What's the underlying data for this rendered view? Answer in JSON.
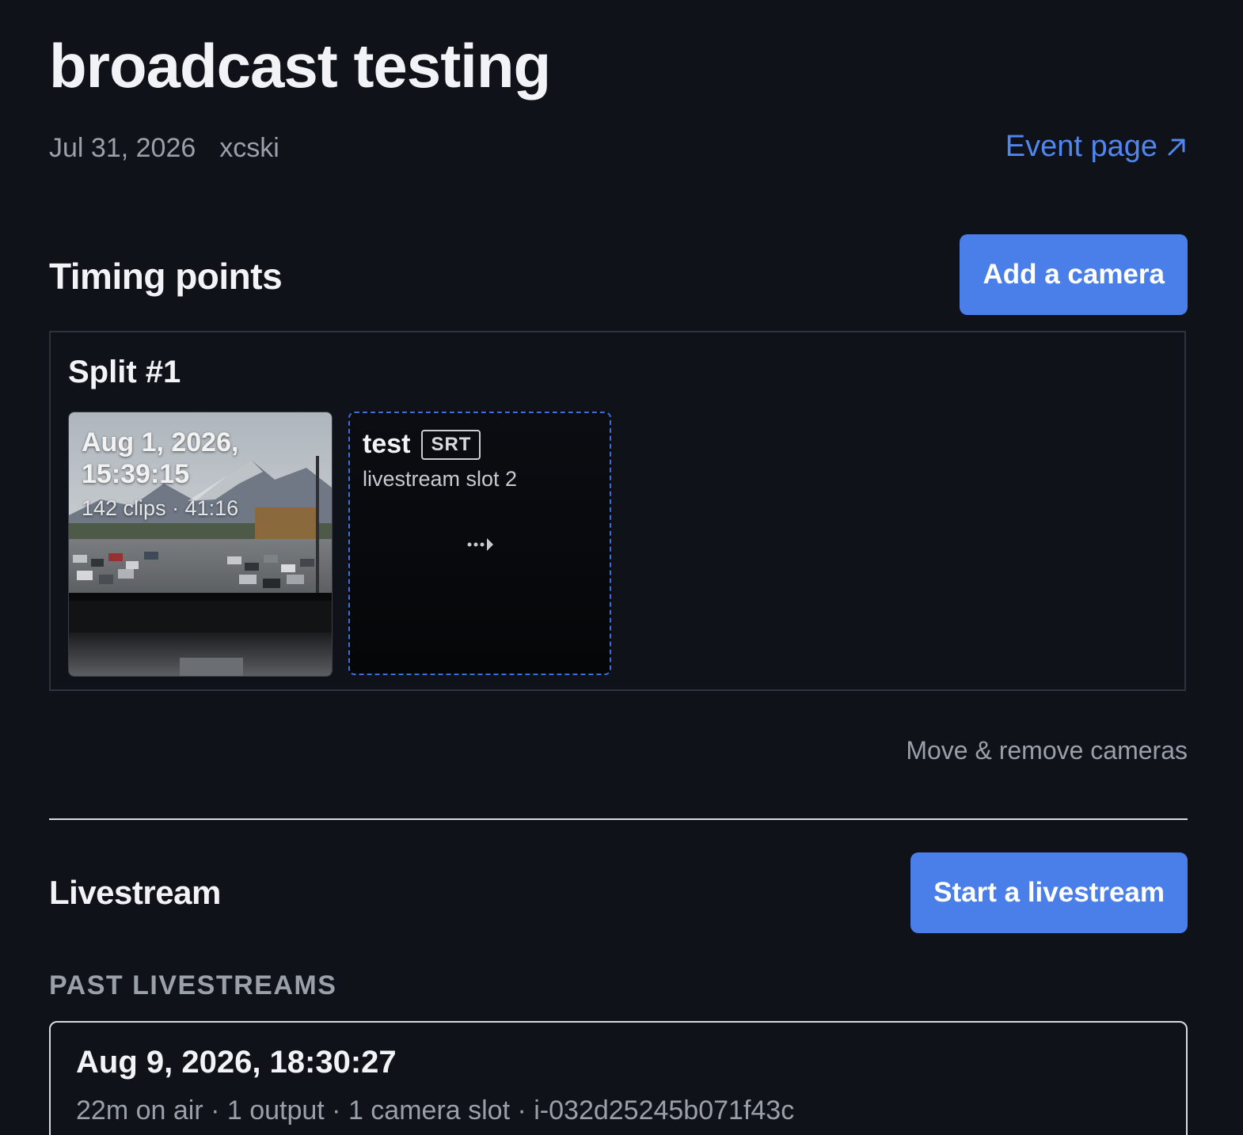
{
  "page": {
    "title": "broadcast testing",
    "date": "Jul 31, 2026",
    "sport": "xcski",
    "event_link": "Event page"
  },
  "timing": {
    "heading": "Timing points",
    "add_camera_label": "Add a camera",
    "split": {
      "title": "Split #1",
      "camera": {
        "date": "Aug 1, 2026, 15:39:15",
        "summary": "142 clips · 41:16"
      },
      "slot": {
        "name": "test",
        "badge": "SRT",
        "subtitle": "livestream slot 2"
      }
    },
    "move_remove_label": "Move & remove cameras"
  },
  "livestream": {
    "heading": "Livestream",
    "start_label": "Start a livestream",
    "past_label": "PAST LIVESTREAMS",
    "past": [
      {
        "date": "Aug 9, 2026, 18:30:27",
        "details": "22m on air · 1 output · 1 camera slot · i-032d25245b071f43c"
      }
    ]
  },
  "colors": {
    "background": "#0f1218",
    "accent": "#4a7fea",
    "link": "#4f86f0",
    "muted": "#9aa0a8"
  },
  "icons": {
    "event_link": "arrow-up-right-icon",
    "slot": "dotted-arrow-right-icon"
  }
}
